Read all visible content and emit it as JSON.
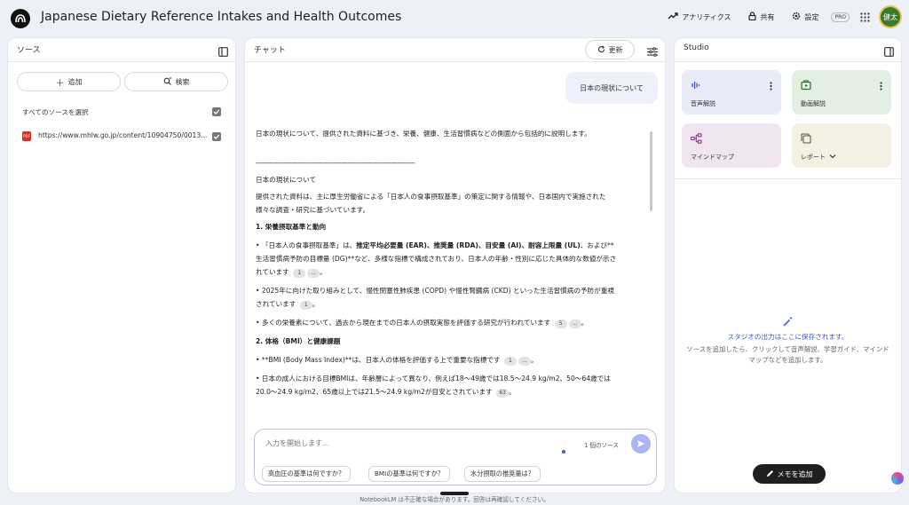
{
  "app": {
    "title": "Japanese Dietary Reference Intakes and Health Outcomes"
  },
  "header": {
    "analytics": "アナリティクス",
    "share": "共有",
    "settings": "設定",
    "pro": "PRO",
    "avatar": "健太"
  },
  "sources": {
    "title": "ソース",
    "add": "追加",
    "search": "検索",
    "select_all": "すべてのソースを選択",
    "items": [
      {
        "label": "https://www.mhlw.go.jp/content/10904750/0013...",
        "badge": "PDF"
      }
    ]
  },
  "chat": {
    "title": "チャット",
    "refresh": "更新",
    "user_message": "日本の現状について",
    "answer": {
      "intro": "日本の現状について、提供された資料に基づき、栄養、健康、生活習慣病などの側面から包括的に説明します。",
      "separator": "--------------------------------------------------------------------------------",
      "heading": "日本の現状について",
      "p1": "提供された資料は、主に厚生労働省による「日本人の食事摂取基準」の策定に関する情報や、日本国内で実施された様々な調査・研究に基づいています。",
      "h1": "1. 栄養摂取基準と動向",
      "b1_pre": "• 「日本人の食事摂取基準」は、",
      "b1_bold": "推定平均必要量 (EAR)、推奨量 (RDA)、目安量 (AI)、耐容上限量 (UL)",
      "b1_post": "、および**生活習慣病予防の目標量 (DG)**など、多様な指標で構成されており、日本人の年齢・性別に応じた具体的な数値が示されています",
      "b1_cite": "1",
      "b2": "• 2025年に向けた取り組みとして、慢性閉塞性肺疾患 (COPD) や慢性腎臓病 (CKD) といった生活習慣病の予防が重視されています",
      "b2_cite": "1",
      "b3": "• 多くの栄養素について、過去から現在までの日本人の摂取実態を評価する研究が行われています",
      "b3_cite": "5",
      "h2": "2. 体格（BMI）と健康課題",
      "b4": "• **BMI (Body Mass Index)**は、日本人の体格を評価する上で重要な指標です",
      "b4_cite": "1",
      "b5": "• 日本の成人における目標BMIは、年齢層によって異なり、例えば18〜49歳では18.5〜24.9 kg/m2、50〜64歳では20.0〜24.9 kg/m2、65歳以上では21.5〜24.9 kg/m2が目安とされています",
      "b5_cite": "63",
      "ellipsis": "..."
    },
    "input_placeholder": "入力を開始します...",
    "source_count": "1 個のソース",
    "suggestions": [
      "高血圧の基準は何ですか？",
      "BMIの基準は何ですか？",
      "水分摂取の推奨量は？"
    ]
  },
  "studio": {
    "title": "Studio",
    "cards": [
      {
        "label": "音声解説",
        "color": "#e9ecf8",
        "icon": "audio-wave-icon",
        "accent": "#3d57c9"
      },
      {
        "label": "動画解説",
        "color": "#e4efe3",
        "icon": "video-icon",
        "accent": "#2f6b34"
      },
      {
        "label": "マインドマップ",
        "color": "#f1e6f0",
        "icon": "mindmap-icon",
        "accent": "#8a3f86"
      },
      {
        "label": "レポート",
        "color": "#f3f1e3",
        "icon": "report-icon",
        "accent": "#5f5a2b"
      }
    ],
    "empty_title": "スタジオの出力はここに保存されます。",
    "empty_desc": "ソースを追加したら、クリックして音声解説、学習ガイド、マインドマップなどを追加します。",
    "add_memo": "メモを追加"
  },
  "footer": "NotebookLM は不正確な場合があります。回答は再確認してください。"
}
